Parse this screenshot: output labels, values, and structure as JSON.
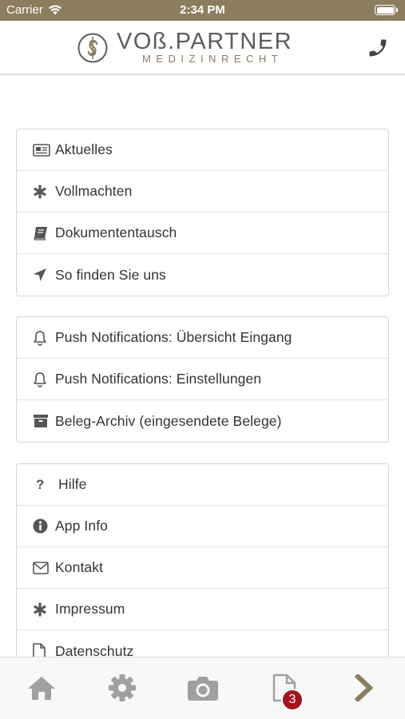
{
  "status_bar": {
    "carrier": "Carrier",
    "time": "2:34 PM"
  },
  "header": {
    "brand_name": "VOß.PARTNER",
    "brand_sub": "MEDIZINRECHT",
    "phone_icon": "phone-icon"
  },
  "menu_groups": [
    {
      "items": [
        {
          "label": "Aktuelles",
          "icon": "newspaper-icon"
        },
        {
          "label": "Vollmachten",
          "icon": "asterisk-icon"
        },
        {
          "label": "Dokumententausch",
          "icon": "book-icon"
        },
        {
          "label": "So finden Sie uns",
          "icon": "location-arrow-icon"
        }
      ]
    },
    {
      "items": [
        {
          "label": "Push Notifications: Übersicht Eingang",
          "icon": "bell-icon"
        },
        {
          "label": "Push Notifications: Einstellungen",
          "icon": "bell-icon"
        },
        {
          "label": "Beleg-Archiv (eingesendete Belege)",
          "icon": "archive-icon"
        }
      ]
    },
    {
      "items": [
        {
          "label": "Hilfe",
          "icon": "question-icon"
        },
        {
          "label": "App Info",
          "icon": "info-icon"
        },
        {
          "label": "Kontakt",
          "icon": "envelope-icon"
        },
        {
          "label": "Impressum",
          "icon": "asterisk-icon"
        },
        {
          "label": "Datenschutz",
          "icon": "file-icon"
        }
      ]
    }
  ],
  "tab_bar": {
    "tabs": [
      {
        "icon": "home-icon"
      },
      {
        "icon": "gear-icon"
      },
      {
        "icon": "camera-icon"
      },
      {
        "icon": "document-icon"
      },
      {
        "icon": "chevron-right-icon"
      }
    ],
    "badge_count": "3"
  },
  "colors": {
    "brand": "#8b7d5e",
    "badge": "#a3141e",
    "icon_gray": "#555555",
    "tab_icon_gray": "#a0a0a0"
  }
}
